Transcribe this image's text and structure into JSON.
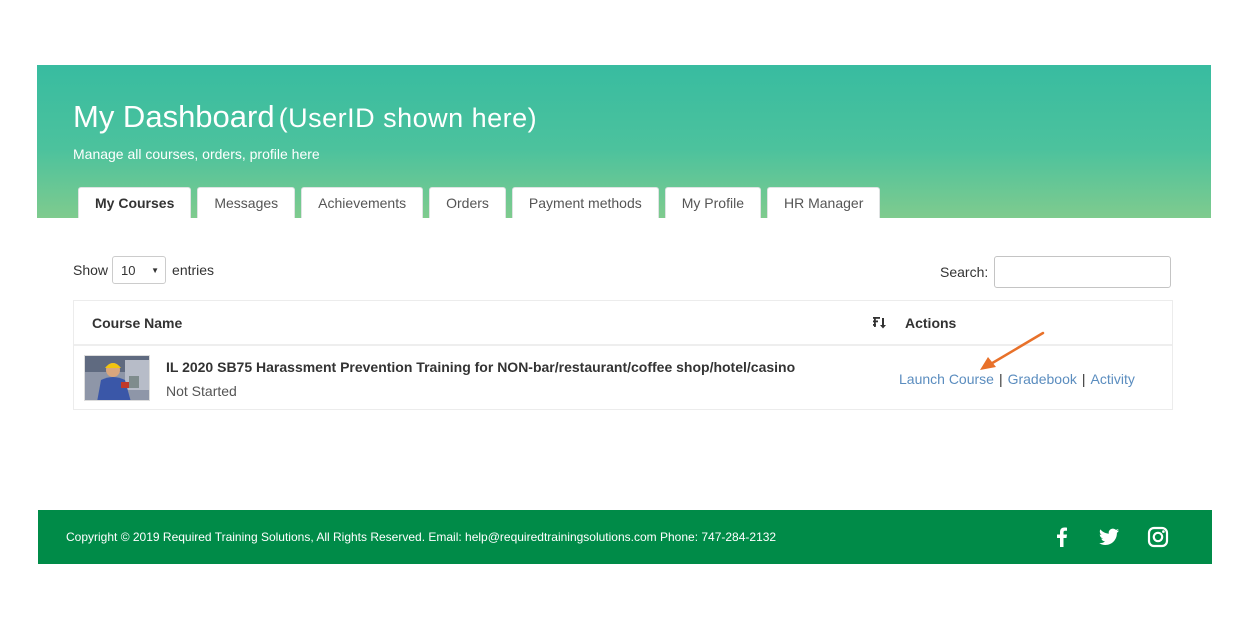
{
  "header": {
    "title": "My Dashboard",
    "userid_note": "(UserID shown here)",
    "subtitle": "Manage all courses, orders, profile here"
  },
  "tabs": [
    {
      "label": "My Courses",
      "active": true
    },
    {
      "label": "Messages",
      "active": false
    },
    {
      "label": "Achievements",
      "active": false
    },
    {
      "label": "Orders",
      "active": false
    },
    {
      "label": "Payment methods",
      "active": false
    },
    {
      "label": "My Profile",
      "active": false
    },
    {
      "label": "HR Manager",
      "active": false
    }
  ],
  "table_controls": {
    "show_label": "Show",
    "entries_value": "10",
    "entries_label": "entries",
    "search_label": "Search:",
    "search_value": ""
  },
  "table": {
    "columns": [
      "Course Name",
      "Actions"
    ],
    "rows": [
      {
        "title": "IL 2020 SB75 Harassment Prevention Training for NON-bar/restaurant/coffee shop/hotel/casino",
        "status": "Not Started",
        "actions": [
          "Launch Course",
          "Gradebook",
          "Activity"
        ],
        "separator": "|"
      }
    ]
  },
  "annotation": {
    "arrow_color": "#e8712a",
    "points_to": "Launch Course"
  },
  "footer": {
    "copyright": "Copyright © 2019 Required Training Solutions, All Rights Reserved. Email: help@requiredtrainingsolutions.com Phone: 747-284-2132",
    "social_icons": [
      "facebook-icon",
      "twitter-icon",
      "instagram-icon"
    ]
  },
  "colors": {
    "header_gradient_top": "#38bca0",
    "header_gradient_bottom": "#7fcb8e",
    "footer_bg": "#008b48",
    "link": "#5b8dbf"
  }
}
